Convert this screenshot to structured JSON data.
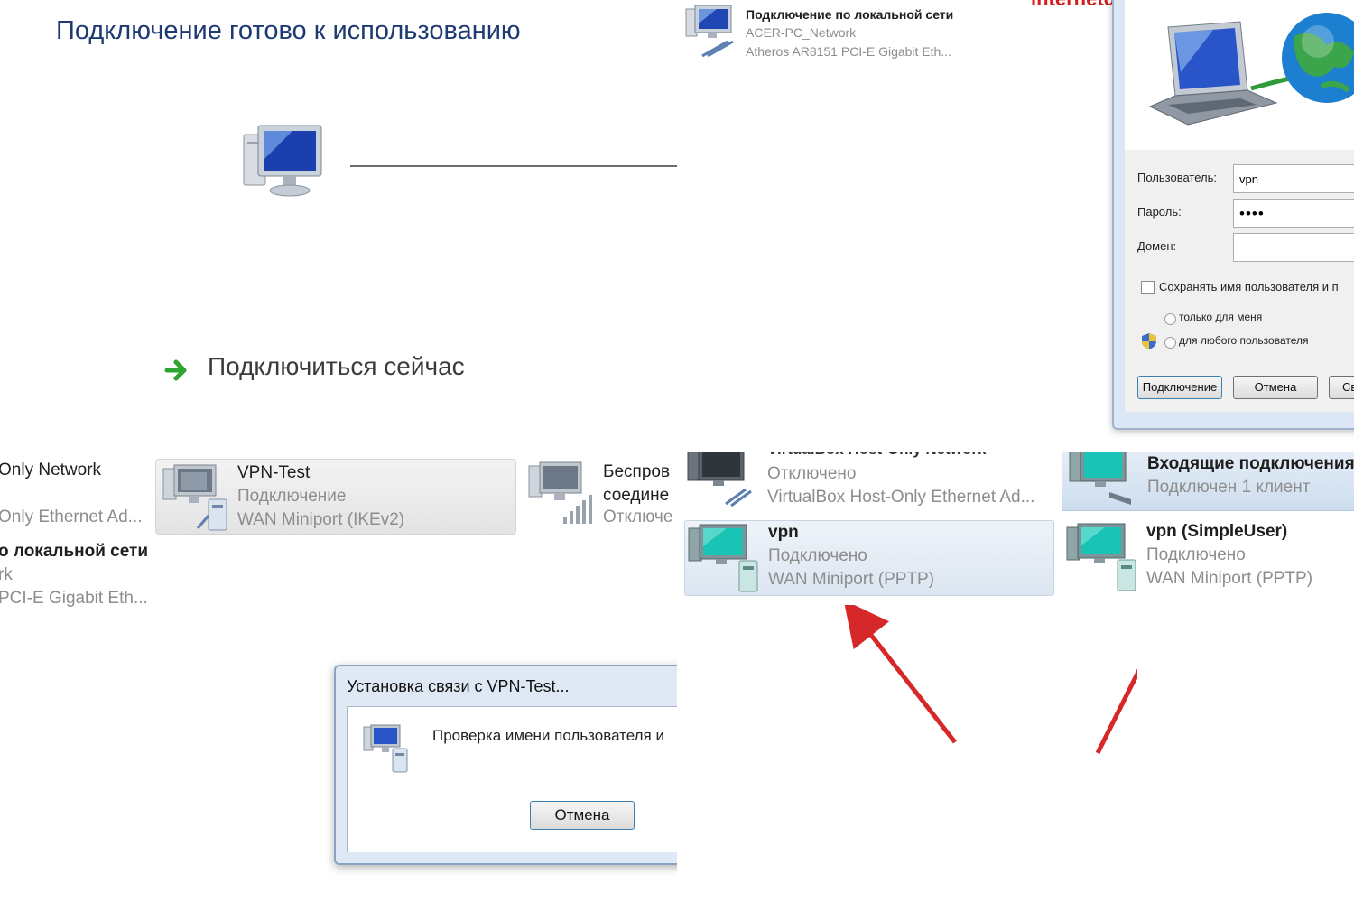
{
  "top_left": {
    "title": "Подключение готово к использованию",
    "connect_now": "Подключиться сейчас"
  },
  "top_right": {
    "lan": {
      "name": "Подключение по локальной сети",
      "network": "ACER-PC_Network",
      "adapter": "Atheros AR8151 PCI-E Gigabit Eth..."
    },
    "watermark": "internetdeyka.ru",
    "dialog": {
      "user_label": "Пользователь:",
      "user_value": "vpn",
      "password_label": "Пароль:",
      "password_value": "••••",
      "domain_label": "Домен:",
      "save_label": "Сохранять имя пользователя и п",
      "only_me": "только для меня",
      "any_user": "для любого пользователя",
      "connect_button": "Подключение",
      "cancel_button": "Отмена",
      "third_button": "Св"
    }
  },
  "bottom_left": {
    "host_only_partial": "Only Network",
    "host_only_adapter_partial": "Only Ethernet Ad...",
    "lan_partial": "о локальной сети",
    "lan_network_partial": "rk",
    "lan_adapter_partial": "PCI-E Gigabit Eth...",
    "vpn_test": {
      "name": "VPN-Test",
      "status": "Подключение",
      "adapter": "WAN Miniport (IKEv2)"
    },
    "wireless": {
      "name_partial": "Беспров",
      "line2_partial": "соедине",
      "status_partial": "Отключе"
    },
    "dialog": {
      "title": "Установка связи с VPN-Test...",
      "message": "Проверка имени пользователя и",
      "cancel_button": "Отмена"
    }
  },
  "bottom_right": {
    "virtualbox": {
      "name_partial": "VirtualBox Host-Only Network",
      "status": "Отключено",
      "adapter": "VirtualBox Host-Only Ethernet Ad..."
    },
    "incoming": {
      "name": "Входящие подключения",
      "status": "Подключен 1 клиент"
    },
    "vpn": {
      "name": "vpn",
      "status": "Подключено",
      "adapter": "WAN Miniport (PPTP)"
    },
    "vpn_simple": {
      "name": "vpn (SimpleUser)",
      "status": "Подключено",
      "adapter": "WAN Miniport (PPTP)"
    }
  }
}
